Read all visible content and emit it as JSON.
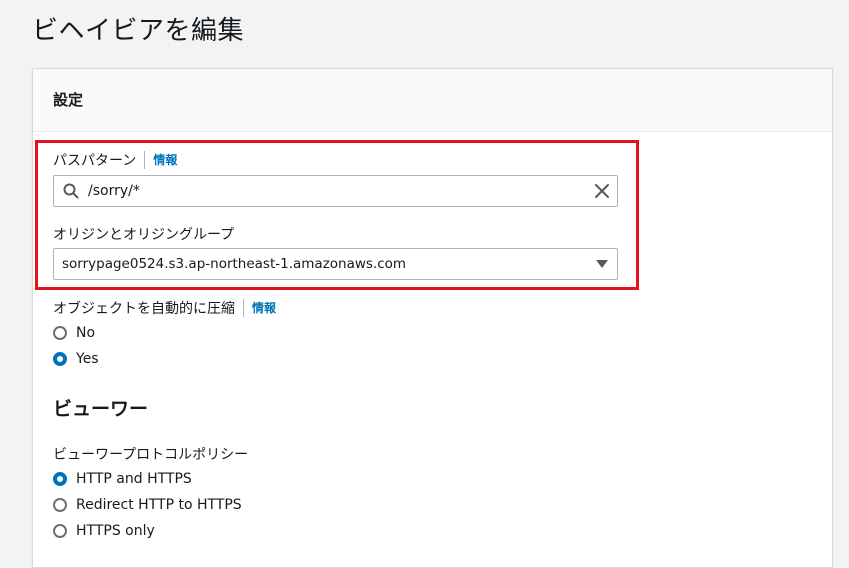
{
  "page": {
    "title": "ビヘイビアを編集"
  },
  "settings_panel": {
    "header": "設定"
  },
  "path_pattern": {
    "label": "パスパターン",
    "info": "情報",
    "value": "/sorry/*"
  },
  "origin": {
    "label": "オリジンとオリジングループ",
    "selected": "sorrypage0524.s3.ap-northeast-1.amazonaws.com"
  },
  "compress": {
    "label": "オブジェクトを自動的に圧縮",
    "info": "情報",
    "options": [
      {
        "label": "No",
        "checked": false
      },
      {
        "label": "Yes",
        "checked": true
      }
    ]
  },
  "viewer": {
    "title": "ビューワー",
    "protocol_label": "ビューワープロトコルポリシー",
    "options": [
      {
        "label": "HTTP and HTTPS",
        "checked": true
      },
      {
        "label": "Redirect HTTP to HTTPS",
        "checked": false
      },
      {
        "label": "HTTPS only",
        "checked": false
      }
    ]
  },
  "colors": {
    "accent": "#0073bb",
    "highlight": "#e0141e"
  },
  "icons": {
    "search": "search-icon",
    "clear": "close-icon",
    "dropdown": "caret-down-icon"
  }
}
